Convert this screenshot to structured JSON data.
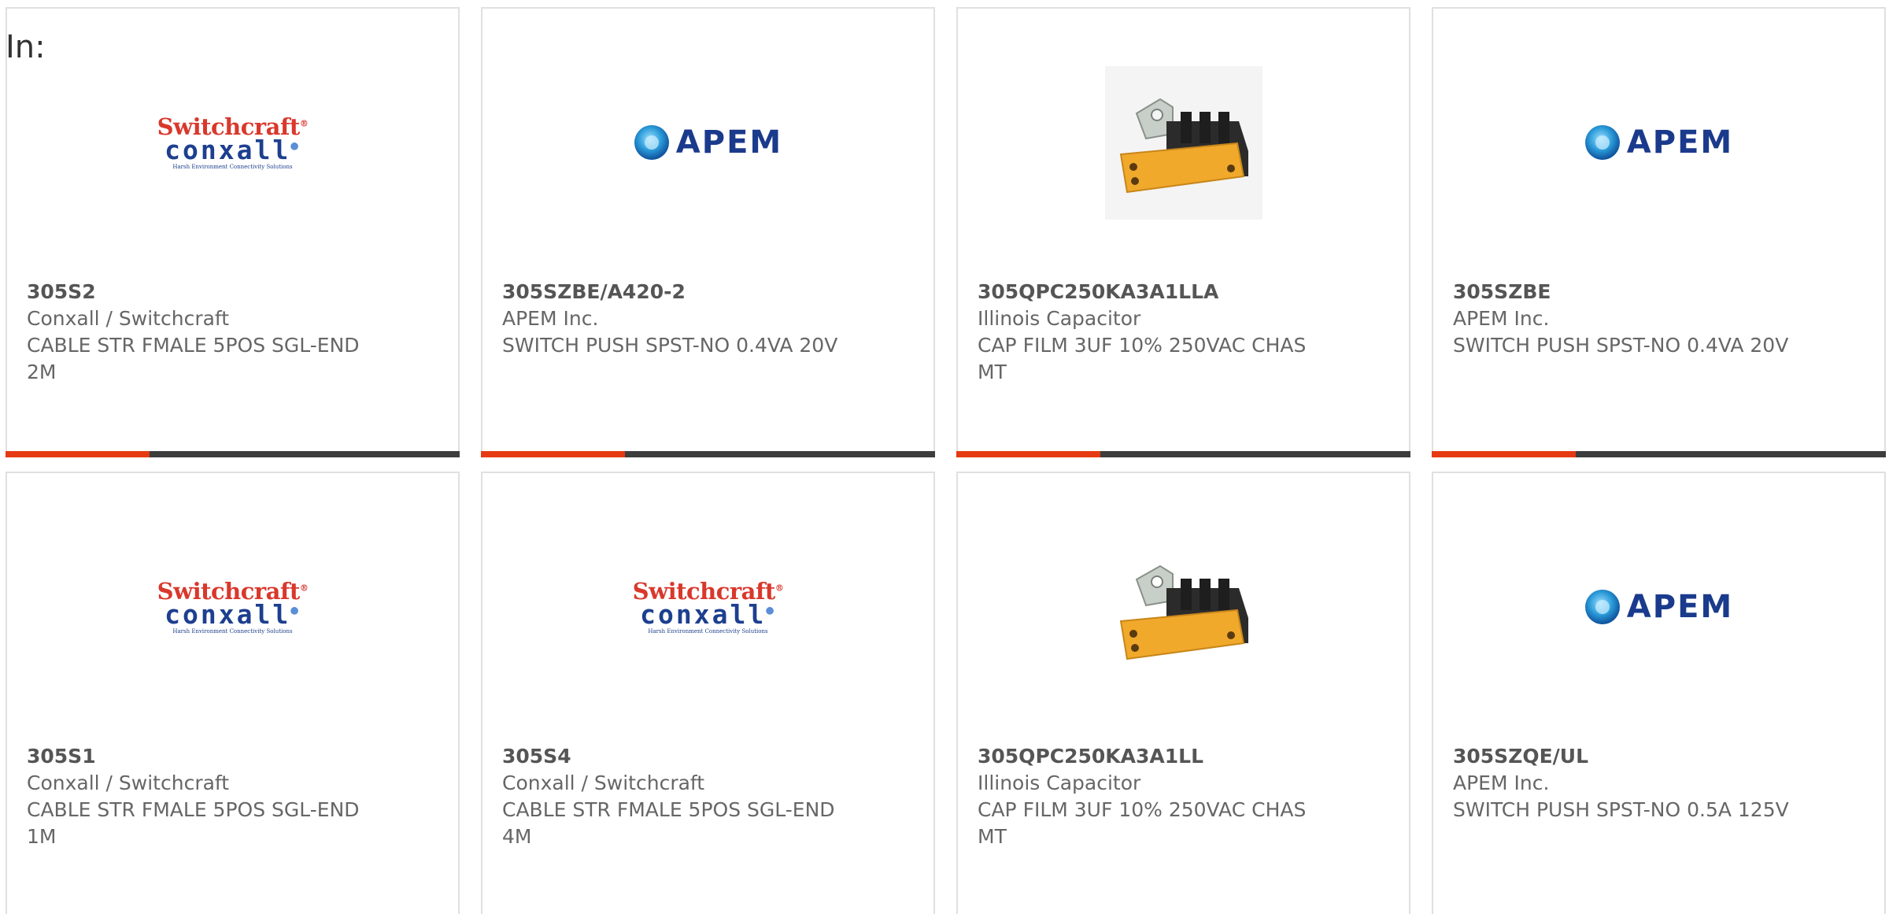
{
  "header": {
    "in_label": "In:"
  },
  "colors": {
    "accent": "#e63a12",
    "bar_dark": "#3d3d3d",
    "apem_blue": "#1a3a8c",
    "switchcraft_red": "#d9382c"
  },
  "logos": {
    "apem": {
      "word": "APEM"
    },
    "switchcraft": {
      "top": "Switchcraft",
      "mid": "conxall",
      "sub": "Harsh Environment Connectivity Solutions"
    }
  },
  "cards": [
    {
      "part_number": "305S2",
      "manufacturer": "Conxall / Switchcraft",
      "description": "CABLE STR FMALE 5POS SGL-END 2M",
      "image": "switchcraft-conxall-logo"
    },
    {
      "part_number": "305SZBE/A420-2",
      "manufacturer": "APEM Inc.",
      "description": "SWITCH PUSH SPST-NO 0.4VA 20V",
      "image": "apem-logo"
    },
    {
      "part_number": "305QPC250KA3A1LLA",
      "manufacturer": "Illinois Capacitor",
      "description": "CAP FILM 3UF 10% 250VAC CHAS MT",
      "image": "capacitor-photo"
    },
    {
      "part_number": "305SZBE",
      "manufacturer": "APEM Inc.",
      "description": "SWITCH PUSH SPST-NO 0.4VA 20V",
      "image": "apem-logo"
    },
    {
      "part_number": "305S1",
      "manufacturer": "Conxall / Switchcraft",
      "description": "CABLE STR FMALE 5POS SGL-END 1M",
      "image": "switchcraft-conxall-logo"
    },
    {
      "part_number": "305S4",
      "manufacturer": "Conxall / Switchcraft",
      "description": "CABLE STR FMALE 5POS SGL-END 4M",
      "image": "switchcraft-conxall-logo"
    },
    {
      "part_number": "305QPC250KA3A1LL",
      "manufacturer": "Illinois Capacitor",
      "description": "CAP FILM 3UF 10% 250VAC CHAS MT",
      "image": "capacitor-photo"
    },
    {
      "part_number": "305SZQE/UL",
      "manufacturer": "APEM Inc.",
      "description": "SWITCH PUSH SPST-NO 0.5A 125V",
      "image": "apem-logo"
    }
  ]
}
